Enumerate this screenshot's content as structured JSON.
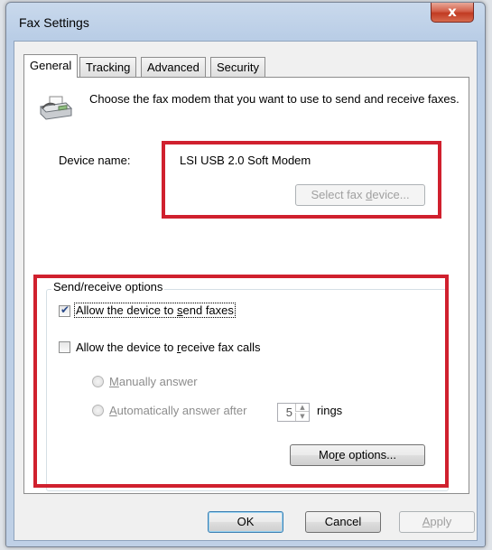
{
  "window": {
    "title": "Fax Settings",
    "close_glyph": "x"
  },
  "tabs": [
    {
      "label": "General",
      "active": true
    },
    {
      "label": "Tracking",
      "active": false
    },
    {
      "label": "Advanced",
      "active": false
    },
    {
      "label": "Security",
      "active": false
    }
  ],
  "general": {
    "intro_text": "Choose the fax modem that you want to use to send and receive faxes.",
    "device_label": "Device name:",
    "device_value": "LSI USB 2.0 Soft Modem",
    "select_device_button": {
      "pre": "Select fax ",
      "accel": "d",
      "post": "evice...",
      "enabled": false
    }
  },
  "send_receive": {
    "group_title": "Send/receive options",
    "allow_send": {
      "pre": "Allow the device to ",
      "accel": "s",
      "post": "end faxes",
      "checked": true
    },
    "allow_receive": {
      "pre": "Allow the device to ",
      "accel": "r",
      "post": "eceive fax calls",
      "checked": false
    },
    "manual_answer": {
      "pre": "",
      "accel": "M",
      "post": "anually answer",
      "selected": false,
      "enabled": false
    },
    "auto_answer": {
      "pre": "",
      "accel": "A",
      "post": "utomatically answer after",
      "selected": false,
      "enabled": false
    },
    "rings_value": "5",
    "rings_label": "rings",
    "more_options_button": {
      "pre": "Mo",
      "accel": "r",
      "post": "e options..."
    }
  },
  "footer": {
    "ok_label": "OK",
    "cancel_label": "Cancel",
    "apply_button": {
      "pre": "",
      "accel": "A",
      "post": "pply",
      "enabled": false
    }
  },
  "highlight_color": "#d0202e"
}
